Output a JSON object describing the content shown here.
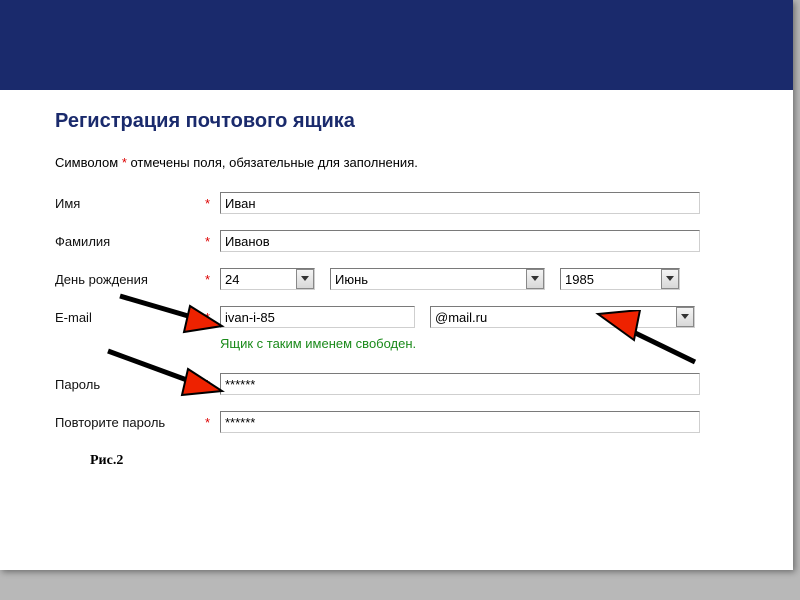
{
  "title": "Регистрация почтового ящика",
  "required_note_pre": "Символом ",
  "required_note_mark": "*",
  "required_note_post": " отмечены поля, обязательные для заполнения.",
  "labels": {
    "first_name": "Имя",
    "last_name": "Фамилия",
    "birthday": "День рождения",
    "email": "E-mail",
    "password": "Пароль",
    "password_repeat": "Повторите пароль"
  },
  "values": {
    "first_name": "Иван",
    "last_name": "Иванов",
    "day": "24",
    "month": "Июнь",
    "year": "1985",
    "email_local": "ivan-i-85",
    "email_domain": "@mail.ru",
    "password": "******",
    "password_repeat": "******"
  },
  "hint": "Ящик с таким именем свободен.",
  "figure_label": "Рис.2",
  "required_mark": "*"
}
